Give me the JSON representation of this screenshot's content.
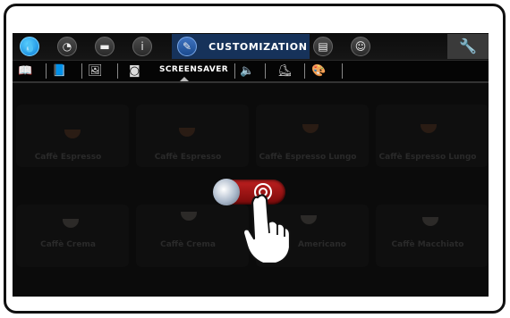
{
  "topbar": {
    "active_tab_label": "CUSTOMIZATION",
    "icons": [
      "water-drop-icon",
      "clock-icon",
      "folder-icon",
      "info-icon",
      "customization-icon",
      "monitor-icon",
      "user-icon",
      "wrench-icon"
    ]
  },
  "subbar": {
    "active_label": "SCREENSAVER",
    "icons": [
      "book-icon",
      "book-image-icon",
      "picture-icon",
      "screensaver-icon",
      "speaker-icon",
      "shoe-icon",
      "palette-icon"
    ]
  },
  "background_tiles": [
    {
      "label": "Caffè Espresso"
    },
    {
      "label": "Caffè Espresso"
    },
    {
      "label": "Caffè Espresso Lungo"
    },
    {
      "label": "Caffè Espresso Lungo"
    },
    {
      "label": "Caffè Crema"
    },
    {
      "label": "Caffè Crema"
    },
    {
      "label": "Americano"
    },
    {
      "label": "Caffè Macchiato"
    }
  ],
  "toggle": {
    "state": "on",
    "color_on": "#b31414"
  },
  "colors": {
    "active_tab": "#16325a",
    "water_icon": "#0a7ed8"
  }
}
